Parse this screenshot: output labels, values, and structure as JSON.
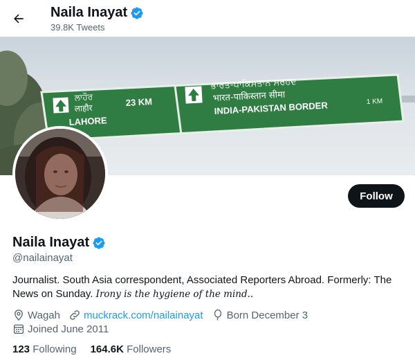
{
  "header": {
    "back_icon": "arrow-left-icon",
    "name": "Naila Inayat",
    "tweet_count": "39.8K Tweets"
  },
  "banner": {
    "city_native_1": "ਲਾਹੌਰ",
    "city_native_2": "लाहौर",
    "city": "LAHORE",
    "distance": "23 KM",
    "border_native_1": "ਭਾਰਤ-ਪਾਕਿਸਤਾਨ ਸਰਹਦ",
    "border_native_2": "भारत-पाकिस्तान सीमा",
    "border": "INDIA-PAKISTAN BORDER",
    "border_distance": "1 KM"
  },
  "profile": {
    "name": "Naila Inayat",
    "verified_icon": "verified-badge-icon",
    "handle": "@nailainayat",
    "bio": "Journalist. South Asia correspondent, Associated Reporters Abroad. Formerly: The News on Sunday.",
    "bio_italic": "Irony is the hygiene of the mind..",
    "location": "Wagah",
    "website": "muckrack.com/nailainayat",
    "birthday": "Born December 3",
    "joined": "Joined June 2011",
    "following_count": "123",
    "following_label": "Following",
    "followers_count": "164.6K",
    "followers_label": "Followers"
  },
  "actions": {
    "follow_label": "Follow"
  },
  "colors": {
    "accent": "#1d9bf0",
    "sign_green": "#2f7d42",
    "text_primary": "#0f1419",
    "text_secondary": "#536471"
  }
}
